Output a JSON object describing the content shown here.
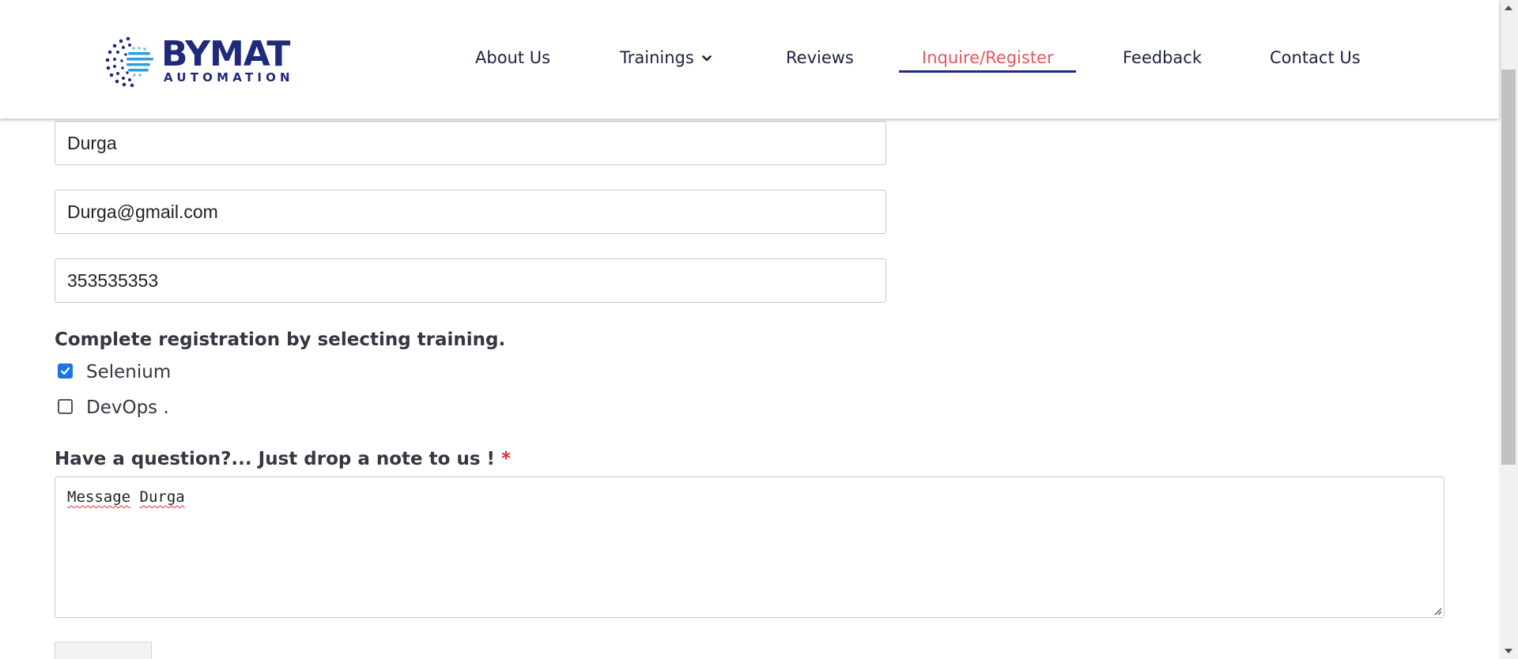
{
  "brand": {
    "name_line1": "BYMAT",
    "name_line2": "AUTOMATION",
    "logo_icon": "dotted-globe-logo-icon",
    "color": "#1f2a7a"
  },
  "nav": {
    "items": [
      {
        "label": "About Us"
      },
      {
        "label": "Trainings",
        "icon": "chevron-down-icon"
      },
      {
        "label": "Reviews"
      },
      {
        "label": "Inquire/Register",
        "active": true
      },
      {
        "label": "Feedback"
      },
      {
        "label": "Contact Us"
      }
    ],
    "active_color": "#e8555e",
    "text_color": "#1c2340"
  },
  "form": {
    "name_value": "Durga",
    "email_value": "Durga@gmail.com",
    "phone_value": "353535353",
    "training_prompt": "Complete registration by selecting training.",
    "trainings": [
      {
        "label": "Selenium",
        "checked": true
      },
      {
        "label": "DevOps .",
        "checked": false
      }
    ],
    "question_label": "Have a question?... Just drop a note to us !",
    "required_marker": "*",
    "message_word1": "Message",
    "message_word2": "Durga"
  },
  "scrollbar": {
    "up_icon": "triangle-up-icon",
    "down_icon": "triangle-down-icon"
  }
}
